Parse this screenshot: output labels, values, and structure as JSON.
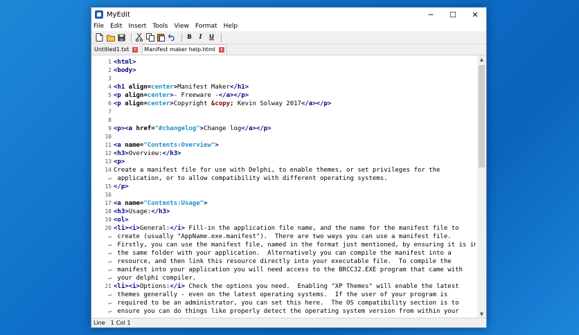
{
  "window": {
    "title": "MyEdit"
  },
  "window_controls": {
    "minimize": "─",
    "maximize": "☐",
    "close": "✕"
  },
  "menu": [
    "File",
    "Edit",
    "Insert",
    "Tools",
    "View",
    "Format",
    "Help"
  ],
  "toolbar": {
    "bold": "B",
    "italic": "I",
    "underline": "U"
  },
  "tabs": [
    {
      "label": "Untitled1.txt",
      "active": false
    },
    {
      "label": "Manifest maker help.html",
      "active": true
    }
  ],
  "tab_close": "x",
  "lines": [
    {
      "n": "1",
      "t": "<html>"
    },
    {
      "n": "2",
      "t": "<body>"
    },
    {
      "n": "3",
      "t": ""
    },
    {
      "n": "4",
      "t": "<h1 align=center>Manifest Maker</h1>"
    },
    {
      "n": "5",
      "t": "<p align=center>- Freeware -</a></p>"
    },
    {
      "n": "6",
      "t": "<p align=center>Copyright &copy; Kevin Solway 2017</a></p>"
    },
    {
      "n": "7",
      "t": ""
    },
    {
      "n": "8",
      "t": ""
    },
    {
      "n": "9",
      "t": "<p><a href=\"#changelog\">Change log</a></p>"
    },
    {
      "n": "10",
      "t": ""
    },
    {
      "n": "11",
      "t": "<a name=\"Contents:Overview\">"
    },
    {
      "n": "12",
      "t": "<h3>Overview:</h3>"
    },
    {
      "n": "13",
      "t": "<p>"
    },
    {
      "n": "14",
      "t": "Create a manifest file for use with Delphi, to enable themes, or set privileges for the"
    },
    {
      "n": "",
      "wrap": true,
      "t": " application, or to allow compatibility with different operating systems."
    },
    {
      "n": "15",
      "t": "</p>"
    },
    {
      "n": "16",
      "t": ""
    },
    {
      "n": "17",
      "t": "<a name=\"Contents:Usage\">"
    },
    {
      "n": "18",
      "t": "<h3>Usage:</h3>"
    },
    {
      "n": "19",
      "t": "<ol>"
    },
    {
      "n": "20",
      "t": "<li><i>General:</i> Fill-in the application file name, and the name for the manifest file to"
    },
    {
      "n": "",
      "wrap": true,
      "t": " create (usually \"AppName.exe.manifest\").  There are two ways you can use a manifest file."
    },
    {
      "n": "",
      "wrap": true,
      "t": " Firstly, you can use the manifest file, named in the format just mentioned, by ensuring it is in"
    },
    {
      "n": "",
      "wrap": true,
      "t": " the same folder with your application.  Alternatively you can compile the manifest into a"
    },
    {
      "n": "",
      "wrap": true,
      "t": " resource, and then link this resource directly into your executable file.  To compile the"
    },
    {
      "n": "",
      "wrap": true,
      "t": " manifest into your application you will need access to the BRCC32.EXE program that came with"
    },
    {
      "n": "",
      "wrap": true,
      "t": " your delphi compiler."
    },
    {
      "n": "21",
      "t": "<li><i>Options:</i> Check the options you need.  Enabling \"XP Themes\" will enable the latest"
    },
    {
      "n": "",
      "wrap": true,
      "t": " themes generally - even on the latest operating systems.  If the user of your program is"
    },
    {
      "n": "",
      "wrap": true,
      "t": " required to be an administrator, you can set this here.  The OS compatibility section is to"
    },
    {
      "n": "",
      "wrap": true,
      "t": " ensure you can do things like properly detect the operating system version from within your"
    }
  ],
  "wrap_glyph": "↵",
  "status": {
    "line_label": "Line",
    "line": "1",
    "col_label": "Col",
    "col": "1"
  },
  "colors": {
    "tag": "#000080",
    "value": "#1e90c8",
    "entity": "#800000"
  }
}
